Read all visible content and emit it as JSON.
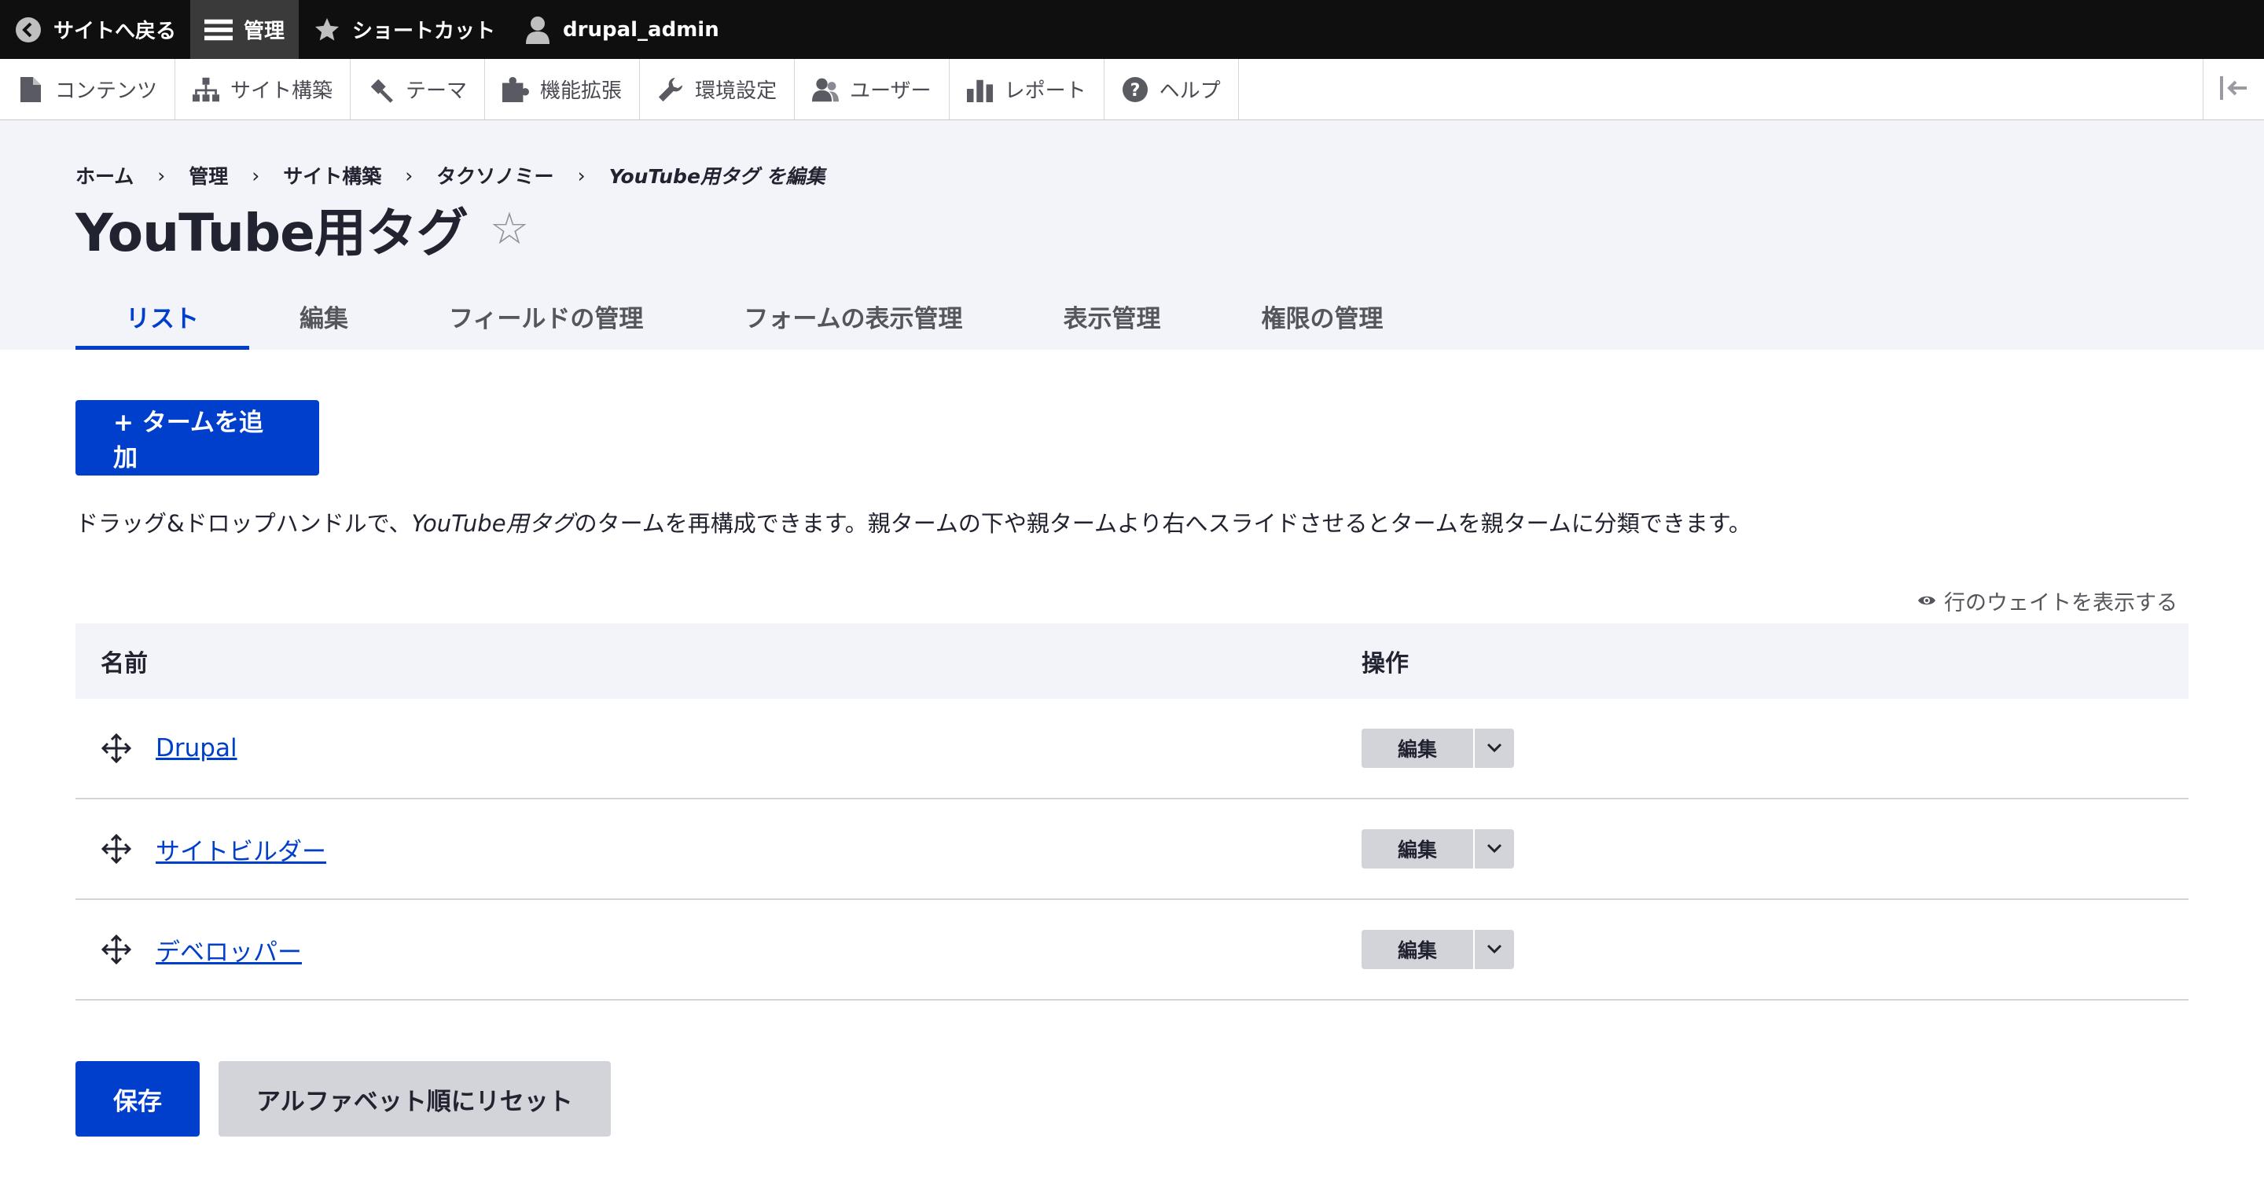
{
  "toolbar": {
    "back_label": "サイトへ戻る",
    "manage_label": "管理",
    "shortcuts_label": "ショートカット",
    "user_label": "drupal_admin"
  },
  "tray": {
    "items": [
      {
        "label": "コンテンツ",
        "icon": "document-icon"
      },
      {
        "label": "サイト構築",
        "icon": "structure-icon"
      },
      {
        "label": "テーマ",
        "icon": "paintbrush-icon"
      },
      {
        "label": "機能拡張",
        "icon": "puzzle-icon"
      },
      {
        "label": "環境設定",
        "icon": "wrench-icon"
      },
      {
        "label": "ユーザー",
        "icon": "people-icon"
      },
      {
        "label": "レポート",
        "icon": "bar-chart-icon"
      },
      {
        "label": "ヘルプ",
        "icon": "help-icon"
      }
    ]
  },
  "breadcrumb": {
    "items": [
      "ホーム",
      "管理",
      "サイト構築",
      "タクソノミー"
    ],
    "current": "YouTube用タグ を編集"
  },
  "page": {
    "title": "YouTube用タグ",
    "star": "☆"
  },
  "tabs": [
    "リスト",
    "編集",
    "フィールドの管理",
    "フォームの表示管理",
    "表示管理",
    "権限の管理"
  ],
  "main": {
    "add_button": "+ タームを追加",
    "help_pre": "ドラッグ&ドロップハンドルで、",
    "help_vocab": "YouTube用タグ",
    "help_post": "のタームを再構成できます。親タームの下や親タームより右へスライドさせるとタームを親タームに分類できます。",
    "show_weights": "行のウェイトを表示する"
  },
  "table": {
    "headers": {
      "name": "名前",
      "operations": "操作"
    },
    "rows": [
      {
        "name": "Drupal",
        "op": "編集"
      },
      {
        "name": "サイトビルダー",
        "op": "編集"
      },
      {
        "name": "デベロッパー",
        "op": "編集"
      }
    ]
  },
  "actions": {
    "save": "保存",
    "reset": "アルファベット順にリセット"
  },
  "colors": {
    "primary": "#003ecc",
    "toolbar_bg": "#0f0f0f",
    "header_bg": "#f3f4f9"
  }
}
